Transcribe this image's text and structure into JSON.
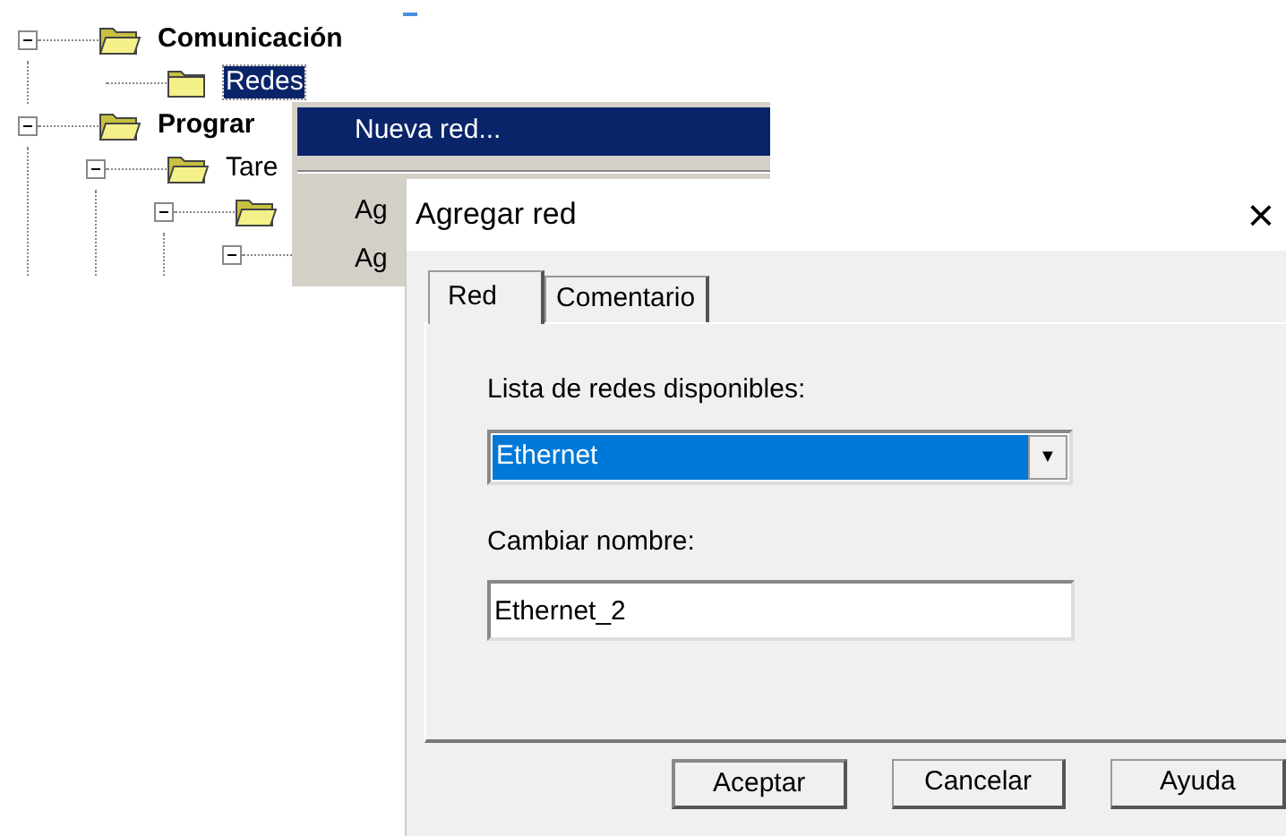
{
  "tree": [
    {
      "label": "Comunicación",
      "bold": true,
      "selected": false,
      "expanded": true,
      "folder": true,
      "children": [
        {
          "label": "Redes",
          "bold": false,
          "selected": true,
          "folder": true
        }
      ]
    },
    {
      "label": "Prograr",
      "bold": true,
      "selected": false,
      "expanded": true,
      "folder": true,
      "children": [
        {
          "label": "Tare",
          "bold": false,
          "selected": false,
          "expanded": true,
          "folder": true,
          "children": [
            {
              "expanded": true,
              "folder": true,
              "children": [
                {
                  "expanded": true,
                  "folder": false
                }
              ]
            }
          ]
        }
      ]
    }
  ],
  "context_menu": [
    {
      "kind": "item",
      "label": "Nueva red...",
      "selected": true
    },
    {
      "kind": "separator"
    },
    {
      "kind": "item",
      "label": "Ag",
      "selected": false
    },
    {
      "kind": "item",
      "label": "Ag",
      "selected": false
    }
  ],
  "dialog": {
    "title": "Agregar red",
    "close": "×",
    "tabs": [
      {
        "label": "Red",
        "selected": true
      },
      {
        "label": "Comentario",
        "selected": false
      }
    ],
    "network_list": {
      "label": "Lista de redes disponibles:",
      "value": "Ethernet",
      "caret": "▼"
    },
    "rename": {
      "label": "Cambiar nombre:",
      "value": "Ethernet_2"
    },
    "buttons": [
      {
        "label": "Aceptar",
        "default": true
      },
      {
        "label": "Cancelar",
        "default": false
      },
      {
        "label": "Ayuda",
        "default": false
      }
    ]
  }
}
